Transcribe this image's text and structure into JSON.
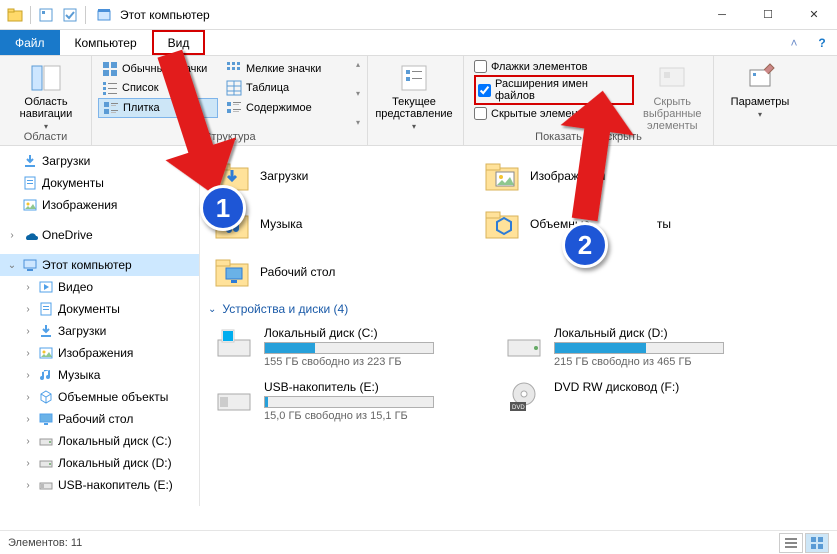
{
  "title": "Этот компьютер",
  "tabs": {
    "file": "Файл",
    "computer": "Компьютер",
    "view": "Вид"
  },
  "ribbon": {
    "navPane": "Область навигации",
    "layouts": {
      "bigIcons": "Обычные значки",
      "smallIcons": "Мелкие значки",
      "list": "Список",
      "table": "Таблица",
      "tiles": "Плитка",
      "content": "Содержимое"
    },
    "structureGroup": "Структура",
    "currentView": "Текущее представление",
    "checks": {
      "itemFlags": "Флажки элементов",
      "fileExt": "Расширения имен файлов",
      "hidden": "Скрытые элементы"
    },
    "hideSelected": "Скрыть выбранные элементы",
    "showHideGroup": "Показать или скрыть",
    "options": "Параметры"
  },
  "addrbarLabel": "Области",
  "sidebar": [
    {
      "label": "Загрузки",
      "icon": "download"
    },
    {
      "label": "Документы",
      "icon": "doc"
    },
    {
      "label": "Изображения",
      "icon": "pic"
    },
    {
      "label": "OneDrive",
      "icon": "onedrive",
      "caret": ">"
    },
    {
      "label": "Этот компьютер",
      "icon": "pc",
      "caret": "v",
      "selected": true
    },
    {
      "label": "Видео",
      "icon": "video",
      "indent": true,
      "caret": ">"
    },
    {
      "label": "Документы",
      "icon": "doc",
      "indent": true,
      "caret": ">"
    },
    {
      "label": "Загрузки",
      "icon": "download",
      "indent": true,
      "caret": ">"
    },
    {
      "label": "Изображения",
      "icon": "pic",
      "indent": true,
      "caret": ">"
    },
    {
      "label": "Музыка",
      "icon": "music",
      "indent": true,
      "caret": ">"
    },
    {
      "label": "Объемные объекты",
      "icon": "3d",
      "indent": true,
      "caret": ">"
    },
    {
      "label": "Рабочий стол",
      "icon": "desktop",
      "indent": true,
      "caret": ">"
    },
    {
      "label": "Локальный диск (C:)",
      "icon": "drive",
      "indent": true,
      "caret": ">"
    },
    {
      "label": "Локальный диск (D:)",
      "icon": "drive",
      "indent": true,
      "caret": ">"
    },
    {
      "label": "USB-накопитель (E:)",
      "icon": "usb",
      "indent": true,
      "caret": ">"
    }
  ],
  "folders": [
    {
      "name": "Загрузки",
      "icon": "download"
    },
    {
      "name": "Изображения",
      "icon": "pic"
    },
    {
      "name": "Музыка",
      "icon": "music"
    },
    {
      "name": "Объемные объекты",
      "icon": "3d",
      "cut": "ты"
    },
    {
      "name": "Рабочий стол",
      "icon": "desktop"
    }
  ],
  "drivesHeader": "Устройства и диски (4)",
  "drives": [
    {
      "name": "Локальный диск (C:)",
      "free": "155 ГБ свободно из 223 ГБ",
      "fill": 30,
      "icon": "win"
    },
    {
      "name": "Локальный диск (D:)",
      "free": "215 ГБ свободно из 465 ГБ",
      "fill": 54,
      "icon": "hdd"
    },
    {
      "name": "USB-накопитель (E:)",
      "free": "15,0 ГБ свободно из 15,1 ГБ",
      "fill": 2,
      "icon": "usb"
    },
    {
      "name": "DVD RW дисковод (F:)",
      "free": "",
      "fill": -1,
      "icon": "dvd"
    }
  ],
  "status": "Элементов: 11",
  "badges": {
    "one": "1",
    "two": "2"
  }
}
